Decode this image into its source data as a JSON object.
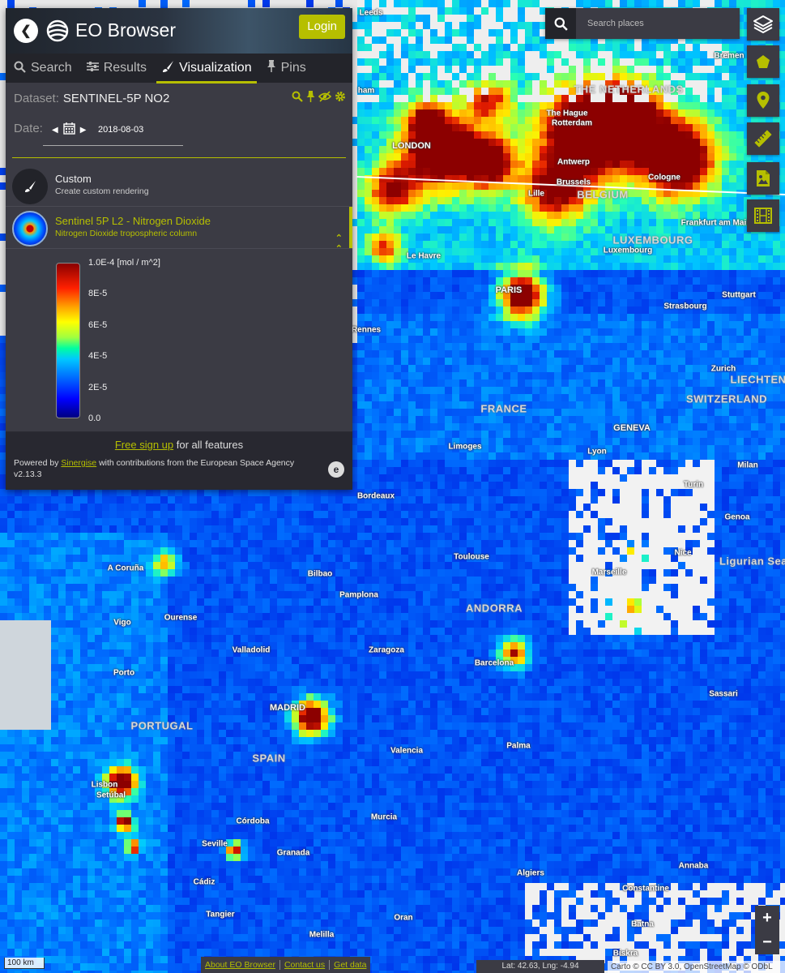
{
  "app": {
    "title": "EO Browser",
    "login_label": "Login"
  },
  "tabs": [
    {
      "label": "Search",
      "icon": "search-icon"
    },
    {
      "label": "Results",
      "icon": "sliders-icon"
    },
    {
      "label": "Visualization",
      "icon": "brush-icon",
      "active": true
    },
    {
      "label": "Pins",
      "icon": "pin-icon"
    }
  ],
  "dataset": {
    "label": "Dataset:",
    "value": "SENTINEL-5P NO2"
  },
  "date": {
    "label": "Date:",
    "value": "2018-08-03"
  },
  "layers": {
    "custom": {
      "name": "Custom",
      "description": "Create custom rendering"
    },
    "selected": {
      "name": "Sentinel 5P L2 - Nitrogen Dioxide",
      "description": "Nitrogen Dioxide tropospheric column"
    }
  },
  "legend": {
    "ticks": [
      {
        "label": "1.0E-4 [mol / m^2]",
        "value": 1.0
      },
      {
        "label": "8E-5",
        "value": 0.8
      },
      {
        "label": "6E-5",
        "value": 0.6
      },
      {
        "label": "4E-5",
        "value": 0.4
      },
      {
        "label": "2E-5",
        "value": 0.2
      },
      {
        "label": "0.0",
        "value": 0.0
      }
    ]
  },
  "footer": {
    "signup_link": "Free sign up",
    "signup_rest": " for all features",
    "powered_prefix": "Powered by ",
    "powered_link": "Sinergise",
    "powered_suffix": " with contributions from the European Space Agency",
    "version": "v2.13.3"
  },
  "search": {
    "placeholder": "Search places"
  },
  "toolbar": [
    "layers-icon",
    "pentagon-icon",
    "location-pin-icon",
    "ruler-icon",
    "image-export-icon",
    "timelapse-film-icon"
  ],
  "zoom": {
    "in": "+",
    "out": "−"
  },
  "scale": "100 km",
  "bottom_links": [
    "About EO Browser",
    "Contact us",
    "Get data"
  ],
  "coords": "Lat: 42.63, Lng: -4.94",
  "attribution": "Carto © CC BY 3.0, OpenStreetMap © ODbL",
  "map": {
    "countries": [
      "THE NETHERLANDS",
      "BELGIUM",
      "LUXEMBOURG",
      "FRANCE",
      "SWITZERLAND",
      "LIECHTEN",
      "ANDORRA",
      "PORTUGAL",
      "SPAIN",
      "Ligurian Sea"
    ],
    "cities": [
      "Leeds",
      "Bremen",
      "The Hague",
      "Rotterdam",
      "LONDON",
      "Antwerp",
      "Brussels",
      "Cologne",
      "Lille",
      "Frankfurt am Main",
      "Luxembourg",
      "Le Havre",
      "PARIS",
      "Stuttgart",
      "Strasbourg",
      "Rennes",
      "Zurich",
      "GENEVA",
      "Limoges",
      "Lyon",
      "Milan",
      "Bordeaux",
      "Turin",
      "Genoa",
      "Nice",
      "Toulouse",
      "Marseille",
      "A Coruña",
      "Bilbao",
      "Pamplona",
      "Vigo",
      "Ourense",
      "Zaragoza",
      "Barcelona",
      "Valladolid",
      "Porto",
      "MADRID",
      "Sassari",
      "Palma",
      "Valencia",
      "Lisbon",
      "Setúbal",
      "Córdoba",
      "Murcia",
      "Seville",
      "Granada",
      "Cádiz",
      "Algiers",
      "Annaba",
      "Constantine",
      "Tangier",
      "Oran",
      "Batna",
      "Melilla",
      "Biskra",
      "ham"
    ]
  }
}
